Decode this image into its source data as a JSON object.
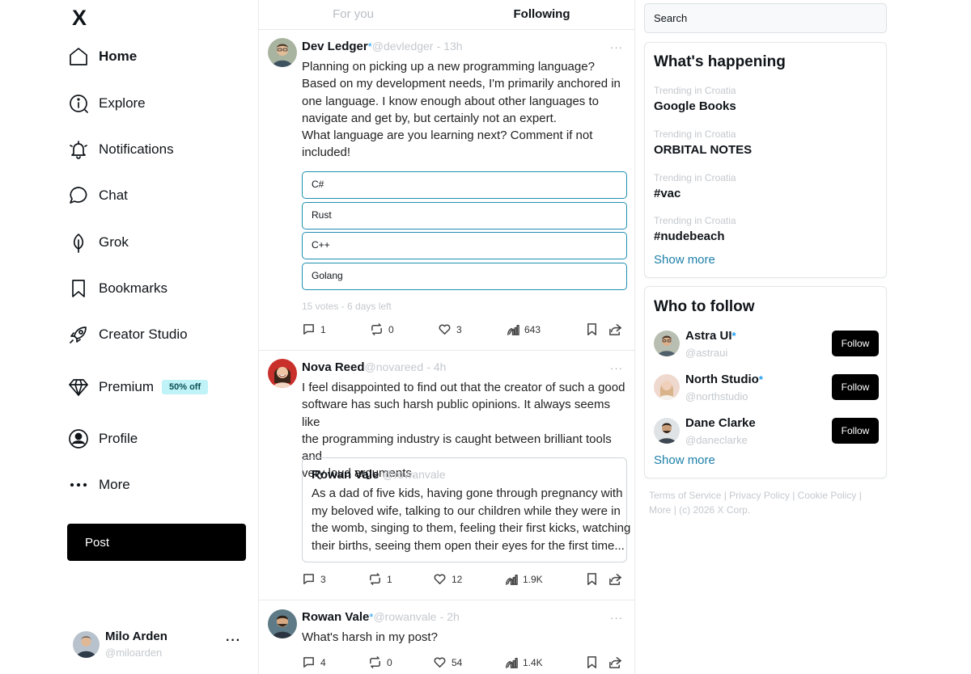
{
  "logo": "X",
  "nav": {
    "home": "Home",
    "explore": "Explore",
    "notifications": "Notifications",
    "chat": "Chat",
    "grok": "Grok",
    "bookmarks": "Bookmarks",
    "creator_studio": "Creator Studio",
    "premium": "Premium",
    "premium_badge": "50% off",
    "profile": "Profile",
    "more": "More",
    "post_button": "Post"
  },
  "account": {
    "name": "Milo Arden",
    "handle": "@miloarden",
    "more": "···"
  },
  "tabs": {
    "for_you": "For you",
    "following": "Following"
  },
  "tweets": [
    {
      "name": "Dev Ledger",
      "verified": "*",
      "handle": "@devledger",
      "time": "- 13h",
      "more": "···",
      "text_lines": [
        "Planning on picking up a new programming language?",
        "Based on my development needs, I'm primarily anchored in",
        "one language. I know enough about other languages to",
        "navigate and get by, but certainly not an expert.",
        "What language are you learning next? Comment if not",
        "included!"
      ],
      "poll": {
        "options": [
          "C#",
          "Rust",
          "C++",
          "Golang"
        ],
        "meta": "15 votes - 6 days left"
      },
      "stats": {
        "replies": "1",
        "reposts": "0",
        "likes": "3",
        "views": "643"
      }
    },
    {
      "name": "Nova Reed",
      "handle": "@novareed",
      "time": "- 4h",
      "more": "···",
      "text_lines": [
        "I feel disappointed to find out that the creator of such a good",
        "software has such harsh public opinions. It always seems like",
        "the programming industry is caught between brilliant tools and",
        "very loud arguments."
      ],
      "quote": {
        "name": "Rowan Vale",
        "handle": "@rowanvale",
        "text_lines": [
          "As a dad of five kids, having gone through pregnancy with",
          "my beloved wife, talking to our children while they were in",
          "the womb, singing to them, feeling their first kicks, watching",
          "their births, seeing them open their eyes for the first time..."
        ]
      },
      "stats": {
        "replies": "3",
        "reposts": "1",
        "likes": "12",
        "views": "1.9K"
      }
    },
    {
      "name": "Rowan Vale",
      "verified": "*",
      "handle": "@rowanvale",
      "time": "- 2h",
      "more": "···",
      "text_lines": [
        "What's harsh in my post?"
      ],
      "stats": {
        "replies": "4",
        "reposts": "0",
        "likes": "54",
        "views": "1.4K"
      }
    }
  ],
  "search": {
    "placeholder": "Search"
  },
  "whats_happening": {
    "title": "What's happening",
    "trends": [
      {
        "meta": "Trending in Croatia",
        "name": "Google Books"
      },
      {
        "meta": "Trending in Croatia",
        "name": "ORBITAL NOTES"
      },
      {
        "meta": "Trending in Croatia",
        "name": "#vac"
      },
      {
        "meta": "Trending in Croatia",
        "name": "#nudebeach"
      }
    ],
    "show_more": "Show more"
  },
  "who_to_follow": {
    "title": "Who to follow",
    "users": [
      {
        "name": "Astra UI",
        "verified": "*",
        "handle": "@astraui",
        "button": "Follow"
      },
      {
        "name": "North Studio",
        "verified": "*",
        "handle": "@northstudio",
        "button": "Follow"
      },
      {
        "name": "Dane Clarke",
        "handle": "@daneclarke",
        "button": "Follow"
      }
    ],
    "show_more": "Show more"
  },
  "footer": {
    "terms": "Terms of Service",
    "privacy": "Privacy Policy",
    "cookie": "Cookie Policy",
    "more": "More",
    "copyright": "(c) 2026 X Corp.",
    "separator": "|"
  },
  "colors": {
    "accent": "#1d9bf0",
    "link": "#1d7fa8",
    "poll_border": "#1f8fb0",
    "badge_bg": "#bff3f7",
    "muted": "#c4c9ce"
  }
}
